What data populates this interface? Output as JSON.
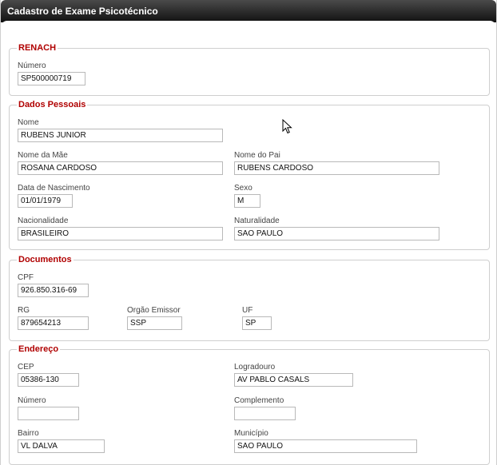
{
  "window": {
    "title": "Cadastro de Exame Psicotécnico"
  },
  "sections": {
    "renach": {
      "legend": "RENACH",
      "numero_label": "Número",
      "numero_value": "SP500000719"
    },
    "dados_pessoais": {
      "legend": "Dados Pessoais",
      "nome_label": "Nome",
      "nome_value": "RUBENS JUNIOR",
      "nome_mae_label": "Nome da Mãe",
      "nome_mae_value": "ROSANA CARDOSO",
      "nome_pai_label": "Nome do Pai",
      "nome_pai_value": "RUBENS CARDOSO",
      "nascimento_label": "Data de Nascimento",
      "nascimento_value": "01/01/1979",
      "sexo_label": "Sexo",
      "sexo_value": "M",
      "nacionalidade_label": "Nacionalidade",
      "nacionalidade_value": "BRASILEIRO",
      "naturalidade_label": "Naturalidade",
      "naturalidade_value": "SAO PAULO"
    },
    "documentos": {
      "legend": "Documentos",
      "cpf_label": "CPF",
      "cpf_value": "926.850.316-69",
      "rg_label": "RG",
      "rg_value": "879654213",
      "orgao_label": "Orgão Emissor",
      "orgao_value": "SSP",
      "uf_label": "UF",
      "uf_value": "SP"
    },
    "endereco": {
      "legend": "Endereço",
      "cep_label": "CEP",
      "cep_value": "05386-130",
      "logradouro_label": "Logradouro",
      "logradouro_value": "AV PABLO CASALS",
      "numero_label": "Número",
      "numero_value": "",
      "complemento_label": "Complemento",
      "complemento_value": "",
      "bairro_label": "Bairro",
      "bairro_value": "VL DALVA",
      "municipio_label": "Município",
      "municipio_value": "SAO PAULO"
    }
  },
  "colors": {
    "legend": "#b00000",
    "titlebar": "#222222"
  },
  "icons": {
    "cursor": "mouse-pointer-icon"
  }
}
